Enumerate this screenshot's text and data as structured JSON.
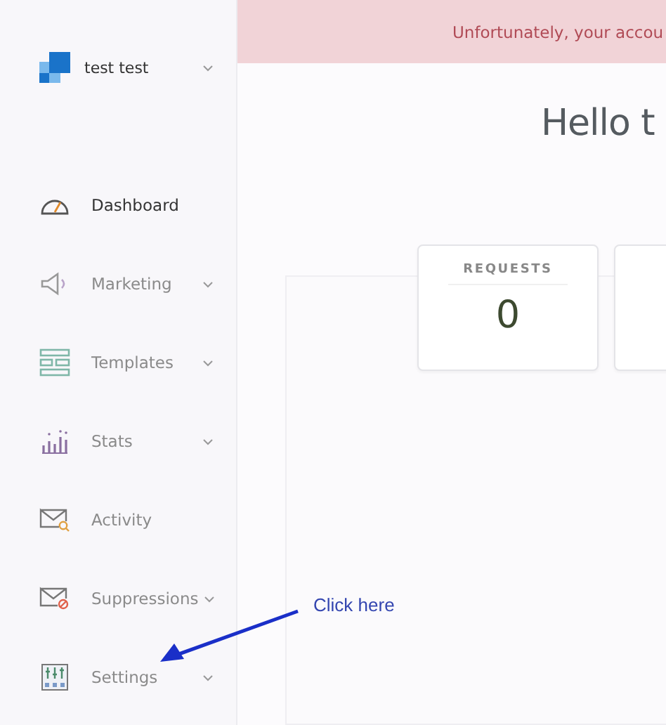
{
  "account": {
    "name": "test test"
  },
  "sidebar": {
    "items": [
      {
        "label": "Dashboard",
        "selected": true,
        "submenu": false
      },
      {
        "label": "Marketing",
        "selected": false,
        "submenu": true
      },
      {
        "label": "Templates",
        "selected": false,
        "submenu": true
      },
      {
        "label": "Stats",
        "selected": false,
        "submenu": true
      },
      {
        "label": "Activity",
        "selected": false,
        "submenu": false
      },
      {
        "label": "Suppressions",
        "selected": false,
        "submenu": true
      },
      {
        "label": "Settings",
        "selected": false,
        "submenu": true
      }
    ]
  },
  "banner": {
    "text": "Unfortunately, your accou"
  },
  "greeting": "Hello t",
  "cards": [
    {
      "kind": "stat",
      "title": "REQUESTS",
      "value": "0"
    },
    {
      "kind": "blank"
    }
  ],
  "annotation": {
    "text": "Click here"
  }
}
